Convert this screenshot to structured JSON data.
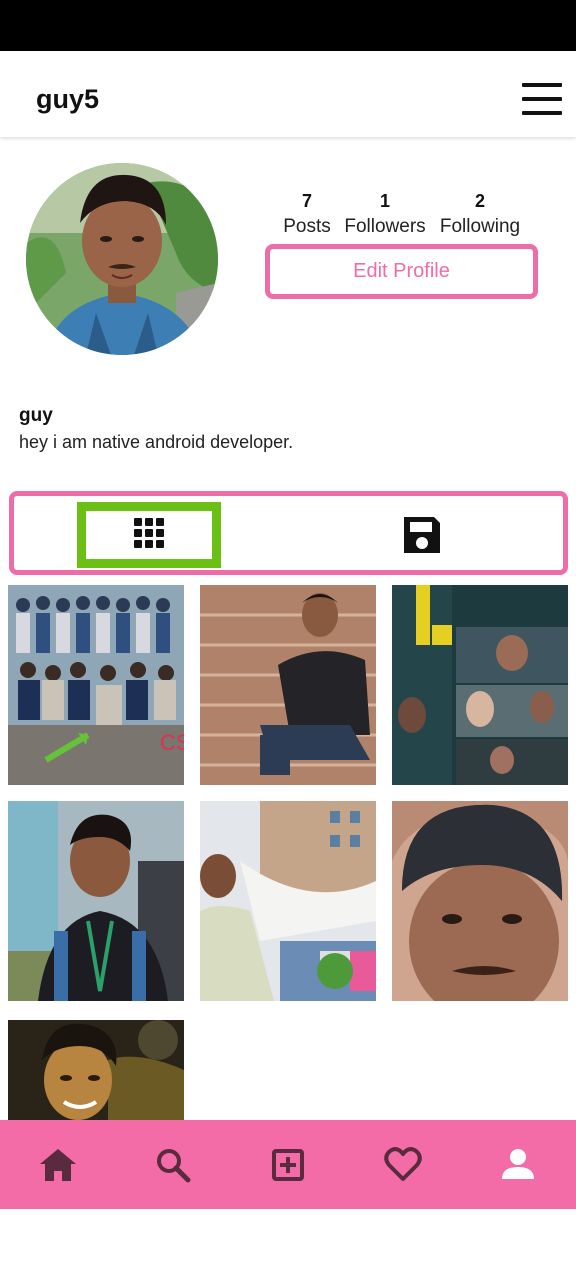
{
  "app_bar": {
    "title": "guy5",
    "menu_icon": "hamburger-menu-icon"
  },
  "profile": {
    "avatar_icon": "profile-photo",
    "stats": [
      {
        "value": "7",
        "label": "Posts"
      },
      {
        "value": "1",
        "label": "Followers"
      },
      {
        "value": "2",
        "label": "Following"
      }
    ],
    "edit_button_label": "Edit Profile",
    "name": "guy",
    "bio": "hey i am native android developer."
  },
  "tabs": [
    {
      "icon": "grid-icon",
      "selected": true
    },
    {
      "icon": "save-icon",
      "selected": false
    }
  ],
  "posts": [
    "group-photo",
    "person-on-stairs",
    "movie-collage",
    "person-with-lanyard",
    "person-outdoors-building",
    "selfie-beanie",
    "selfie-night"
  ],
  "bottom_nav": [
    {
      "icon": "home-icon"
    },
    {
      "icon": "search-icon"
    },
    {
      "icon": "add-post-icon"
    },
    {
      "icon": "heart-icon"
    },
    {
      "icon": "profile-icon"
    }
  ],
  "colors": {
    "accent_pink": "#ee6da9",
    "nav_pink": "#f36ca7",
    "highlight_green": "#6cc015",
    "nav_icon": "#5a2a3f"
  }
}
